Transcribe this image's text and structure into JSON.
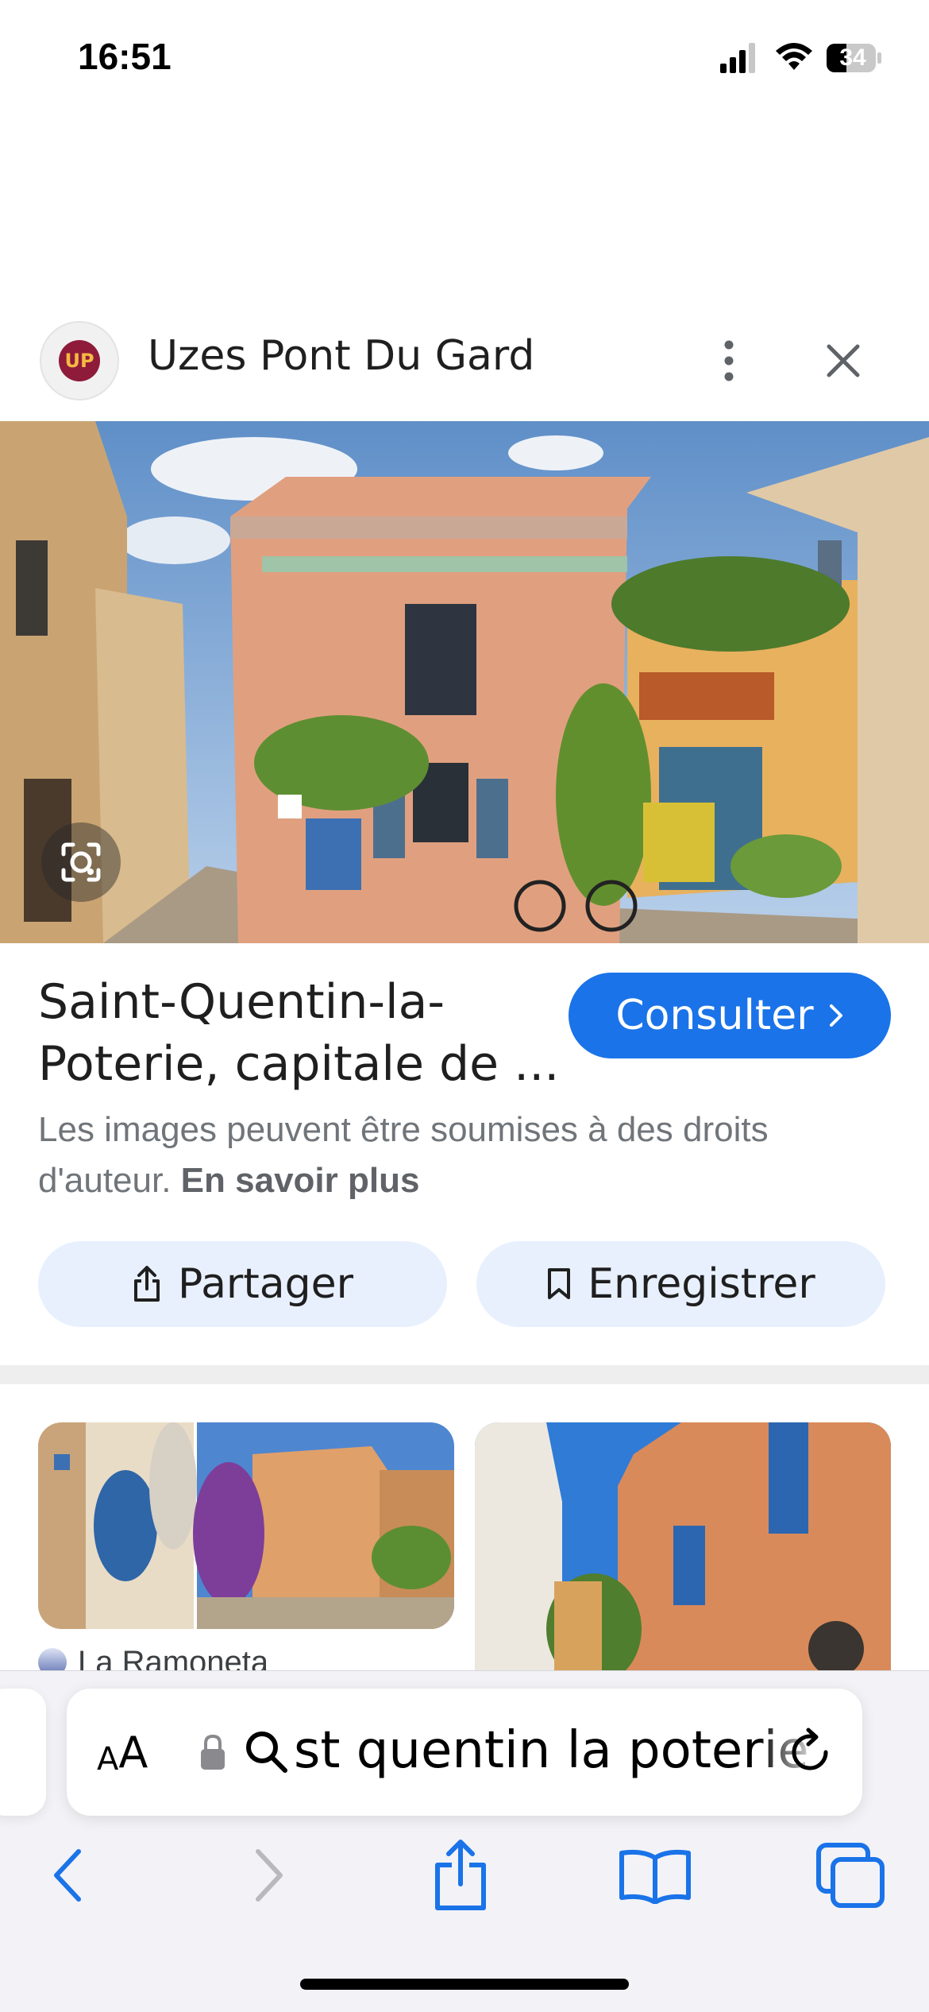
{
  "status_bar": {
    "time": "16:51",
    "battery": "34",
    "icons": [
      "cellular-signal-icon",
      "wifi-icon",
      "battery-icon"
    ]
  },
  "header": {
    "logo_text": "UP",
    "site_name": "Uzes Pont Du Gard",
    "icons": [
      "more-vertical-icon",
      "close-icon"
    ]
  },
  "result": {
    "title": "Saint-Quentin-la-Poterie, capitale de ...",
    "visit_label": "Consulter",
    "rights_text": "Les images peuvent être soumises à des droits d'auteur.",
    "learn_more": "En savoir plus",
    "share_label": "Partager",
    "save_label": "Enregistrer",
    "accent_color": "#1a73e8",
    "chip_color": "#e8f0fe"
  },
  "related": {
    "items": [
      {
        "source": "La Ramoneta"
      },
      {
        "source": ""
      }
    ]
  },
  "safari": {
    "text_size_small": "A",
    "text_size_big": "A",
    "query": "st quentin la poterie",
    "icons": [
      "lock-icon",
      "search-icon",
      "reload-icon",
      "back-icon",
      "forward-icon",
      "share-icon",
      "bookmarks-icon",
      "tabs-icon"
    ]
  }
}
